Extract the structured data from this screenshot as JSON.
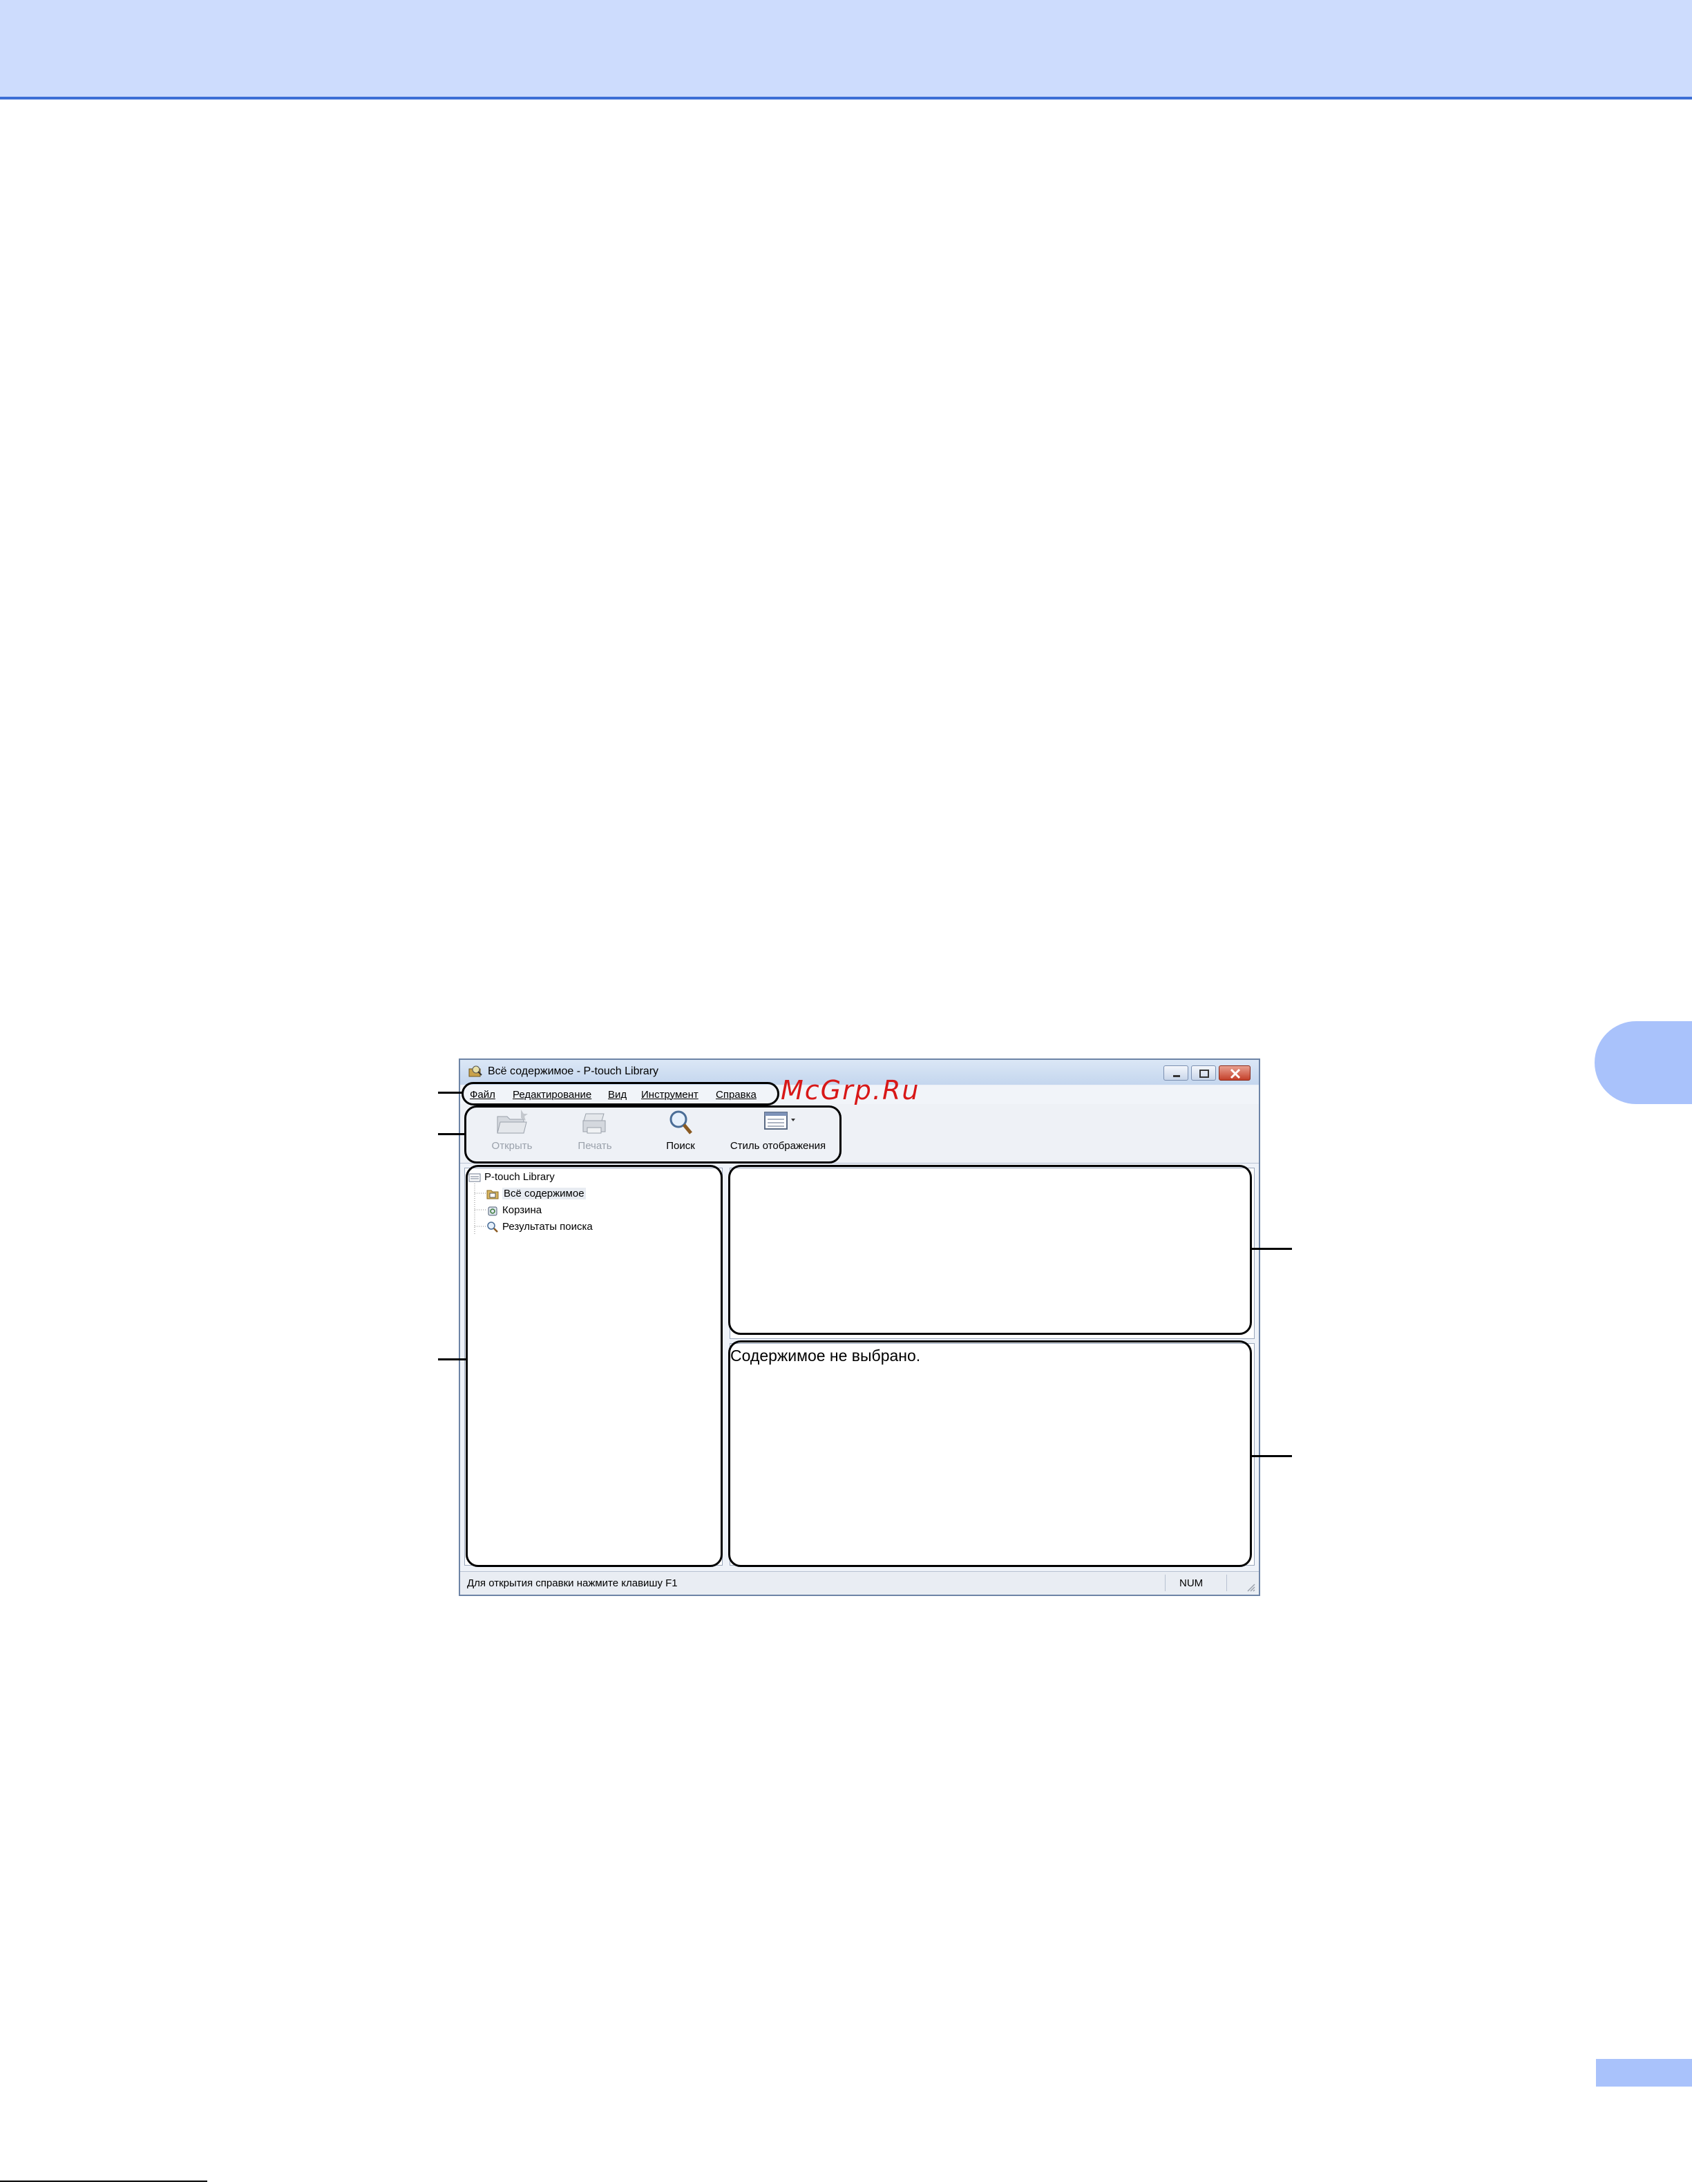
{
  "window": {
    "title": "Всё содержимое - P-touch Library"
  },
  "menu": [
    {
      "label": "Файл"
    },
    {
      "label": "Редактирование"
    },
    {
      "label": "Вид"
    },
    {
      "label": "Инструмент"
    },
    {
      "label": "Справка"
    }
  ],
  "toolbar": {
    "open_label": "Открыть",
    "print_label": "Печать",
    "search_label": "Поиск",
    "view_style_label": "Стиль отображения"
  },
  "tree": {
    "root": "P-touch Library",
    "items": [
      {
        "label": "Всё содержимое",
        "icon": "folder-icon"
      },
      {
        "label": "Корзина",
        "icon": "recycle-bin-icon"
      },
      {
        "label": "Результаты поиска",
        "icon": "search-icon"
      }
    ]
  },
  "preview": {
    "no_content_text": "Содержимое не выбрано."
  },
  "statusbar": {
    "help_text": "Для открытия справки нажмите клавишу F1",
    "num_indicator": "NUM"
  },
  "watermark": {
    "text": "McGrp.Ru",
    "color": "#d81818"
  },
  "colors": {
    "header_band": "#cddcfd",
    "accent": "#3d6fd6",
    "side_tab": "#a9c2fb"
  }
}
